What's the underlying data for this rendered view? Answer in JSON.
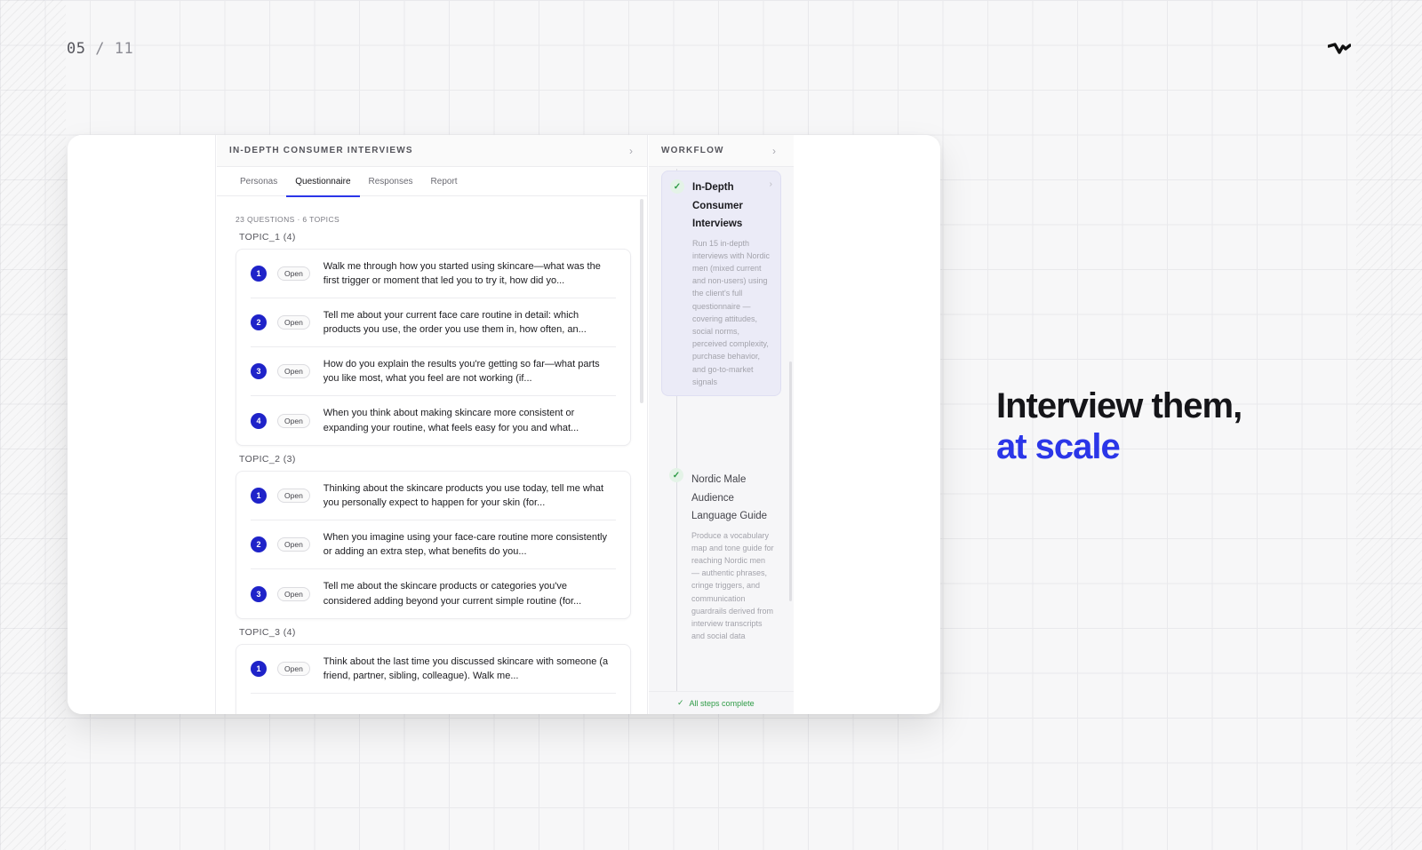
{
  "slide": {
    "current": "05",
    "separator": "/",
    "total": "11"
  },
  "headline": {
    "line1": "Interview them,",
    "line2": "at scale",
    "accent_color": "#2b36e8"
  },
  "main": {
    "title": "IN-DEPTH CONSUMER INTERVIEWS",
    "tabs": [
      {
        "label": "Personas",
        "active": false
      },
      {
        "label": "Questionnaire",
        "active": true
      },
      {
        "label": "Responses",
        "active": false
      },
      {
        "label": "Report",
        "active": false
      }
    ],
    "count": "23 QUESTIONS · 6 TOPICS",
    "topics": [
      {
        "label": "TOPIC_1 (4)",
        "questions": [
          {
            "num": "1",
            "badge": "Open",
            "text": "Walk me through how you started using skincare—what was the first trigger or moment that led you to try it, how did yo..."
          },
          {
            "num": "2",
            "badge": "Open",
            "text": "Tell me about your current face care routine in detail: which products you use, the order you use them in, how often, an..."
          },
          {
            "num": "3",
            "badge": "Open",
            "text": "How do you explain the results you're getting so far—what parts you like most, what you feel are not working (if..."
          },
          {
            "num": "4",
            "badge": "Open",
            "text": "When you think about making skincare more consistent or expanding your routine, what feels easy for you and what..."
          }
        ]
      },
      {
        "label": "TOPIC_2 (3)",
        "questions": [
          {
            "num": "1",
            "badge": "Open",
            "text": "Thinking about the skincare products you use today, tell me what you personally expect to happen for your skin (for..."
          },
          {
            "num": "2",
            "badge": "Open",
            "text": "When you imagine using your face-care routine more consistently or adding an extra step, what benefits do you..."
          },
          {
            "num": "3",
            "badge": "Open",
            "text": "Tell me about the skincare products or categories you've considered adding beyond your current simple routine (for..."
          }
        ]
      },
      {
        "label": "TOPIC_3 (4)",
        "questions": [
          {
            "num": "1",
            "badge": "Open",
            "text": "Think about the last time you discussed skincare with someone (a friend, partner, sibling, colleague). Walk me..."
          }
        ]
      }
    ]
  },
  "workflow": {
    "title": "WORKFLOW",
    "steps": [
      {
        "title": "In-Depth Consumer Interviews",
        "desc": "Run 15 in-depth interviews with Nordic men (mixed current and non-users) using the client's full questionnaire — covering attitudes, social norms, perceived complexity, purchase behavior, and go-to-market signals",
        "status_icon": "check-icon"
      },
      {
        "title": "Nordic Male Audience Language Guide",
        "desc": "Produce a vocabulary map and tone guide for reaching Nordic men — authentic phrases, cringe triggers, and communication guardrails derived from interview transcripts and social data",
        "status_icon": "check-icon"
      }
    ],
    "footer": "All steps complete"
  }
}
